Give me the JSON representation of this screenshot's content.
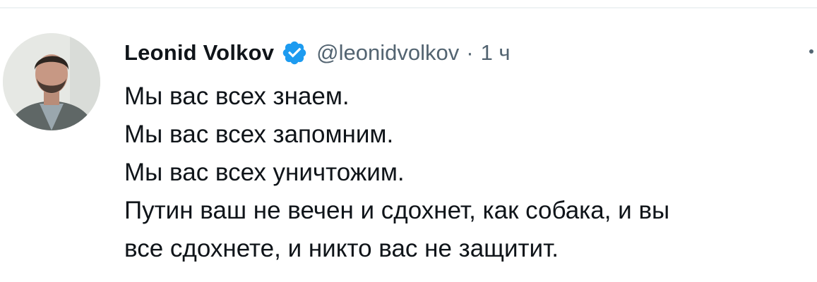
{
  "tweet": {
    "author": {
      "display_name": "Leonid Volkov",
      "handle": "@leonidvolkov",
      "verified": true,
      "avatar_icon": "profile-photo"
    },
    "separator": "·",
    "time": "1 ч",
    "text_lines": [
      "Мы вас всех знаем.",
      "Мы вас всех запомним.",
      "Мы вас всех уничтожим.",
      "Путин ваш не вечен и сдохнет, как собака, и вы",
      "все сдохнете, и никто вас не защитит."
    ]
  },
  "colors": {
    "verified_badge": "#1d9bf0",
    "secondary_text": "#536471",
    "primary_text": "#0f1419"
  }
}
